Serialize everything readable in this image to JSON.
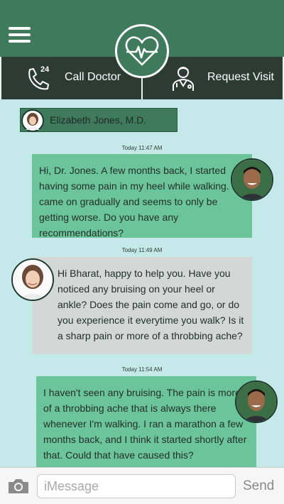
{
  "header": {
    "menu_icon": "hamburger-menu-icon",
    "logo_icon": "heart-pulse-icon"
  },
  "actions": {
    "call_doctor_label": "Call Doctor",
    "call_doctor_badge": "24",
    "call_icon": "phone-icon",
    "request_visit_label": "Request Visit",
    "request_icon": "doctor-icon"
  },
  "doctor": {
    "name": "Elizabeth Jones, M.D."
  },
  "messages": [
    {
      "timestamp": "Today 11:47 AM",
      "sender": "patient",
      "text": "Hi, Dr. Jones.  A few months back, I started having some pain in my heel while walking. It came on gradually and seems to only be getting worse.  Do you have any recommendations?"
    },
    {
      "timestamp": "Today 11:49 AM",
      "sender": "doctor",
      "text": "Hi Bharat, happy to help you.  Have you noticed any bruising on your heel or ankle?  Does the pain come and go, or do you experience it everytime you walk?  Is it a sharp pain or more of a throbbing ache?"
    },
    {
      "timestamp": "Today 11:54 AM",
      "sender": "patient",
      "text": "I haven't seen any bruising.  The pain is more of a throbbing ache that is always there whenever I'm walking.  I ran a marathon a few months back, and I think it started shortly after that.  Could that have caused this?"
    }
  ],
  "composer": {
    "placeholder": "iMessage",
    "send_label": "Send",
    "camera_icon": "camera-icon"
  },
  "colors": {
    "header_green": "#3f7a5c",
    "dark_button": "#2c3c34",
    "patient_bubble": "#6cc49a",
    "doctor_bubble": "#d2d8d5",
    "background": "#c5e8e8"
  }
}
